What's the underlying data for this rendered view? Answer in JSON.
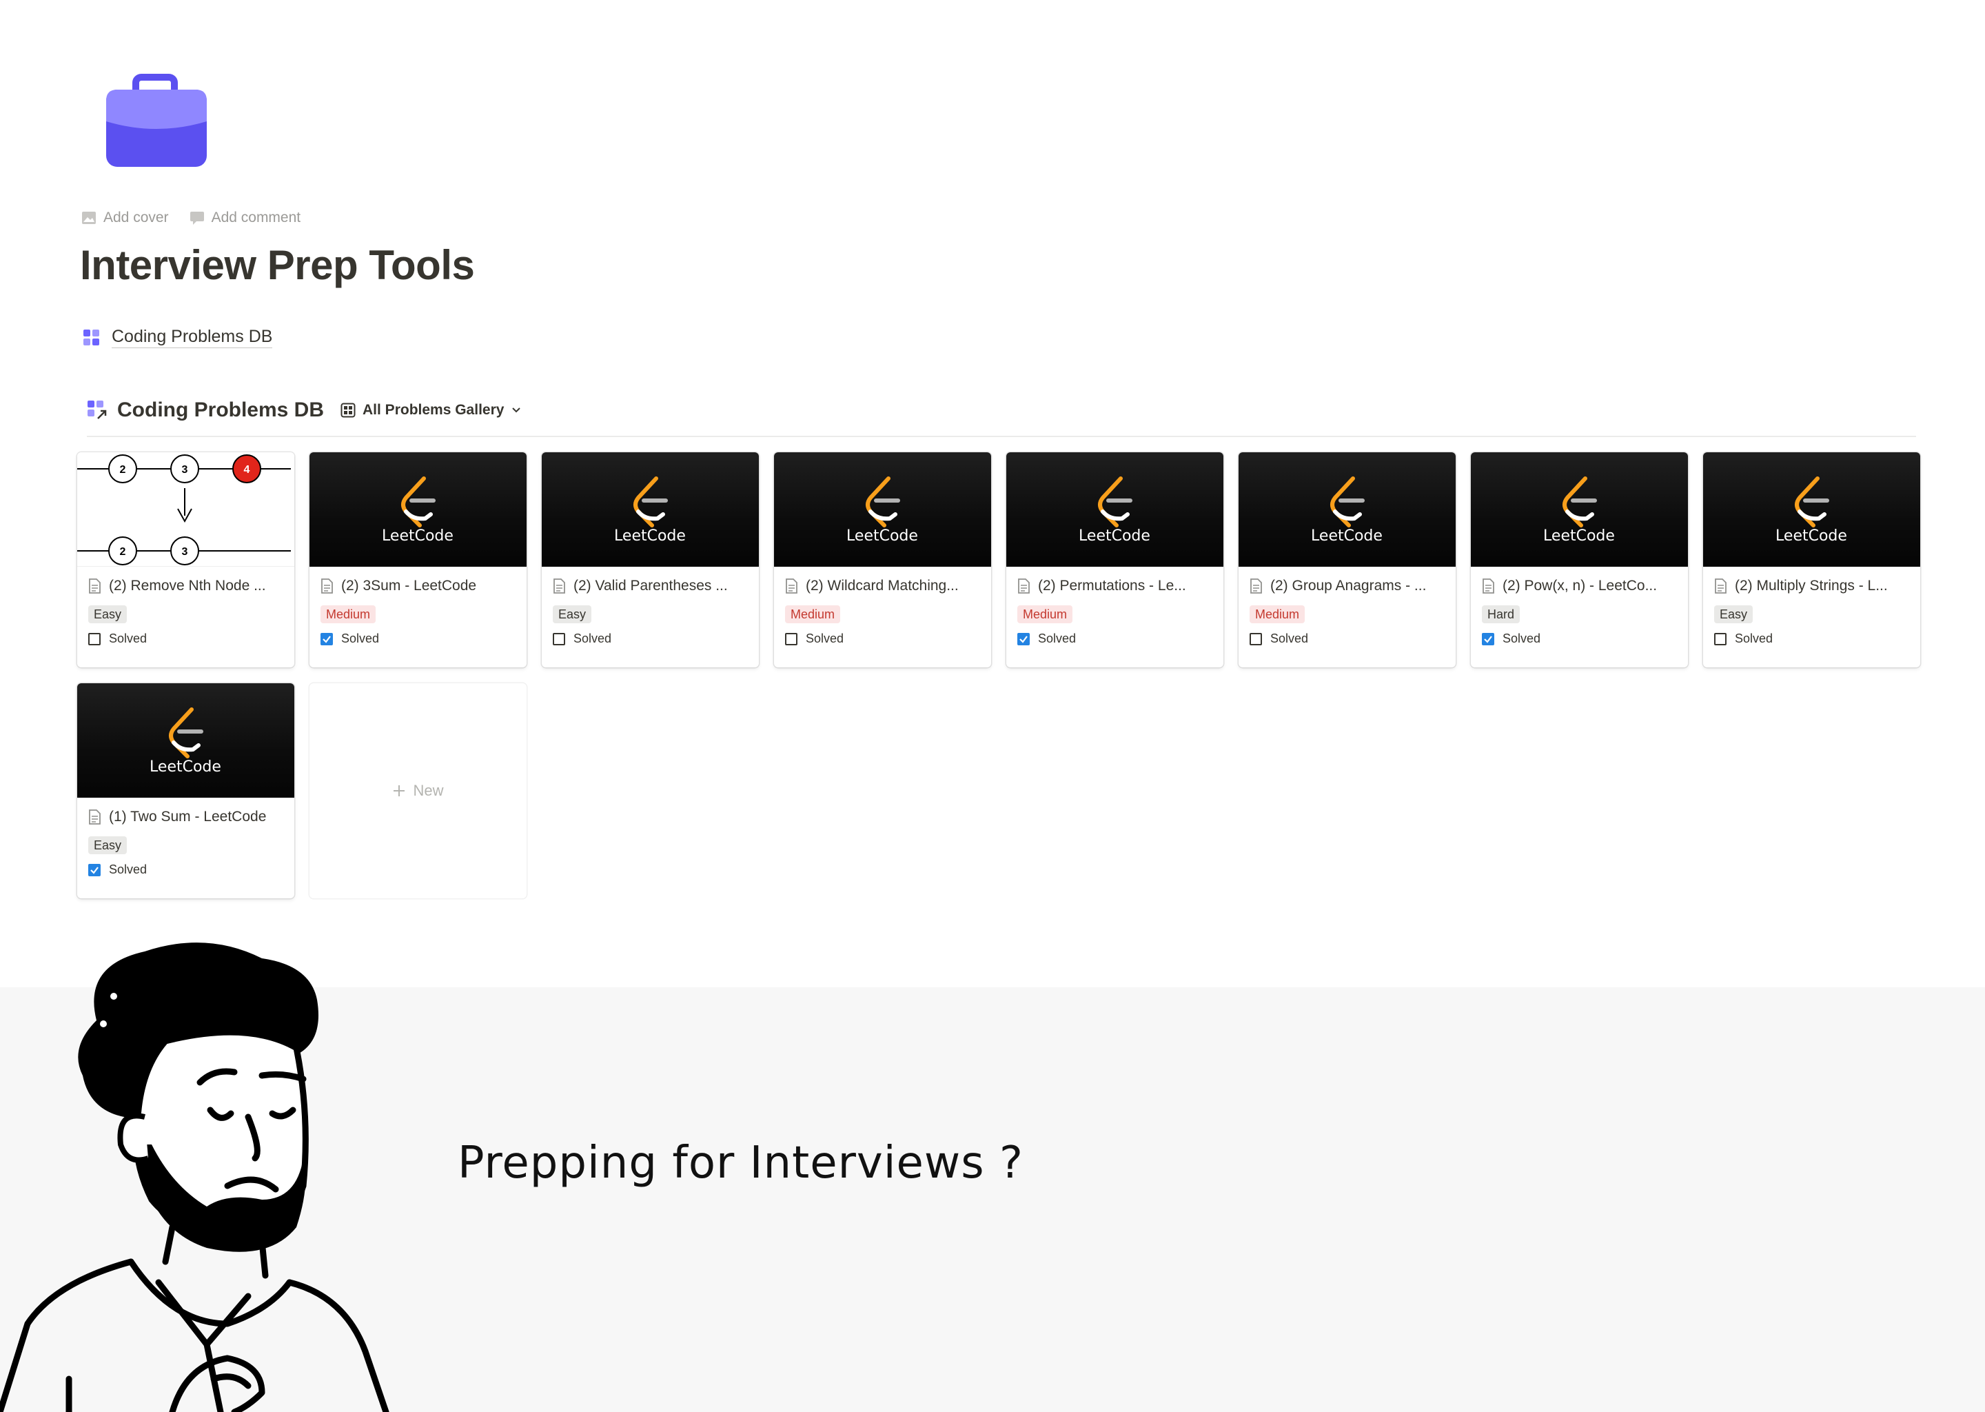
{
  "page": {
    "icon": "briefcase-icon",
    "add_cover": "Add cover",
    "add_comment": "Add comment",
    "title": "Interview Prep Tools"
  },
  "linked_db": {
    "label": "Coding Problems DB",
    "icon": "gallery-db-icon"
  },
  "database": {
    "title": "Coding Problems DB",
    "view_label": "All Problems Gallery",
    "new_label": "New",
    "cards": [
      {
        "title": "(2) Remove Nth Node ...",
        "difficulty": "Easy",
        "solved_label": "Solved",
        "solved": false,
        "cover": "diagram"
      },
      {
        "title": "(2) 3Sum - LeetCode",
        "difficulty": "Medium",
        "solved_label": "Solved",
        "solved": true,
        "cover": "leetcode"
      },
      {
        "title": "(2) Valid Parentheses ...",
        "difficulty": "Easy",
        "solved_label": "Solved",
        "solved": false,
        "cover": "leetcode"
      },
      {
        "title": "(2) Wildcard Matching...",
        "difficulty": "Medium",
        "solved_label": "Solved",
        "solved": false,
        "cover": "leetcode"
      },
      {
        "title": "(2) Permutations - Le...",
        "difficulty": "Medium",
        "solved_label": "Solved",
        "solved": true,
        "cover": "leetcode"
      },
      {
        "title": "(2) Group Anagrams - ...",
        "difficulty": "Medium",
        "solved_label": "Solved",
        "solved": false,
        "cover": "leetcode"
      },
      {
        "title": "(2) Pow(x, n) - LeetCo...",
        "difficulty": "Hard",
        "solved_label": "Solved",
        "solved": true,
        "cover": "leetcode"
      },
      {
        "title": "(2) Multiply Strings - L...",
        "difficulty": "Easy",
        "solved_label": "Solved",
        "solved": false,
        "cover": "leetcode"
      },
      {
        "title": "(1) Two Sum - LeetCode",
        "difficulty": "Easy",
        "solved_label": "Solved",
        "solved": true,
        "cover": "leetcode"
      }
    ],
    "leetcode_wordmark": "LeetCode",
    "diagram_nodes_top": [
      "2",
      "3",
      "4"
    ],
    "diagram_nodes_bottom": [
      "2",
      "3"
    ]
  },
  "banner": {
    "tagline": "Prepping for Interviews ?"
  },
  "colors": {
    "medium_bg": "#fbe4e4",
    "medium_text": "#c4392f",
    "checkbox_on": "#2383e2",
    "icon_purple": "#6c63ff"
  }
}
